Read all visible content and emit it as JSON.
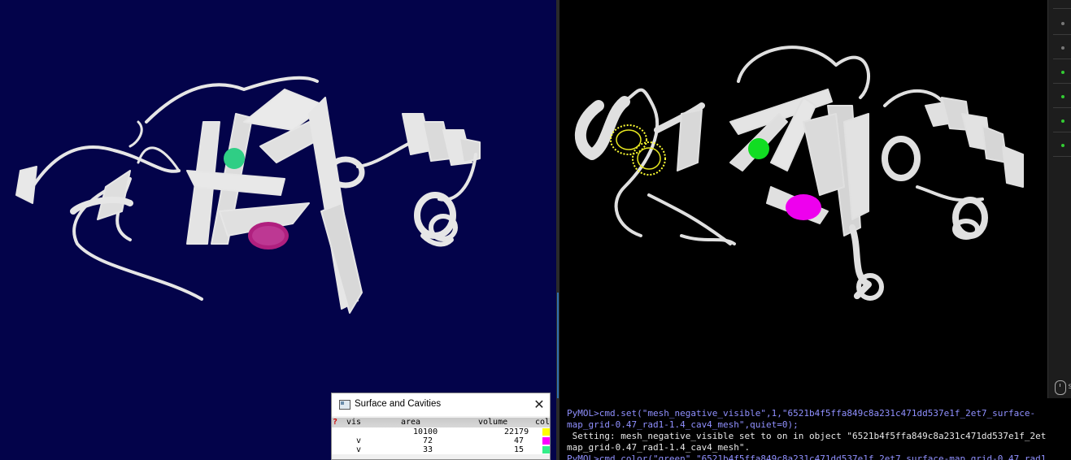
{
  "dialog": {
    "title": "Surface and Cavities",
    "close_label": "✕",
    "headers": {
      "help": "?",
      "vis": "vis",
      "area": "area",
      "volume": "volume",
      "color": "col"
    },
    "rows": [
      {
        "vis": "",
        "area": "10100",
        "volume": "22179",
        "color": "#ffff00"
      },
      {
        "vis": "v",
        "area": "72",
        "volume": "47",
        "color": "#ff00ff"
      },
      {
        "vis": "v",
        "area": "33",
        "volume": "15",
        "color": "#33ee88"
      }
    ]
  },
  "console": {
    "line1": "PyMOL>cmd.set(\"mesh_negative_visible\",1,\"6521b4f5ffa849c8a231c471dd537e1f_2et7_surface-",
    "line2": "map_grid-0.47_rad1-1.4_cav4_mesh\",quiet=0);",
    "line3": " Setting: mesh_negative_visible set to on in object \"6521b4f5ffa849c8a231c471dd537e1f_2et",
    "line4": "map_grid-0.47_rad1-1.4_cav4_mesh\".",
    "line5": "PyMOL>cmd.color(\"green\",\"6521b4f5ffa849c8a231c471dd537e1f_2et7_surface-map_grid-0.47_rad1"
  },
  "side_panel": {
    "mouse_label": "s"
  },
  "colors": {
    "left_bg": "#03034a",
    "right_bg": "#000000",
    "ribbon": "#e8e8e8",
    "cavity_green": "#33dd88",
    "cavity_magenta": "#ee00ee",
    "cavity_yellow": "#ffff33"
  }
}
